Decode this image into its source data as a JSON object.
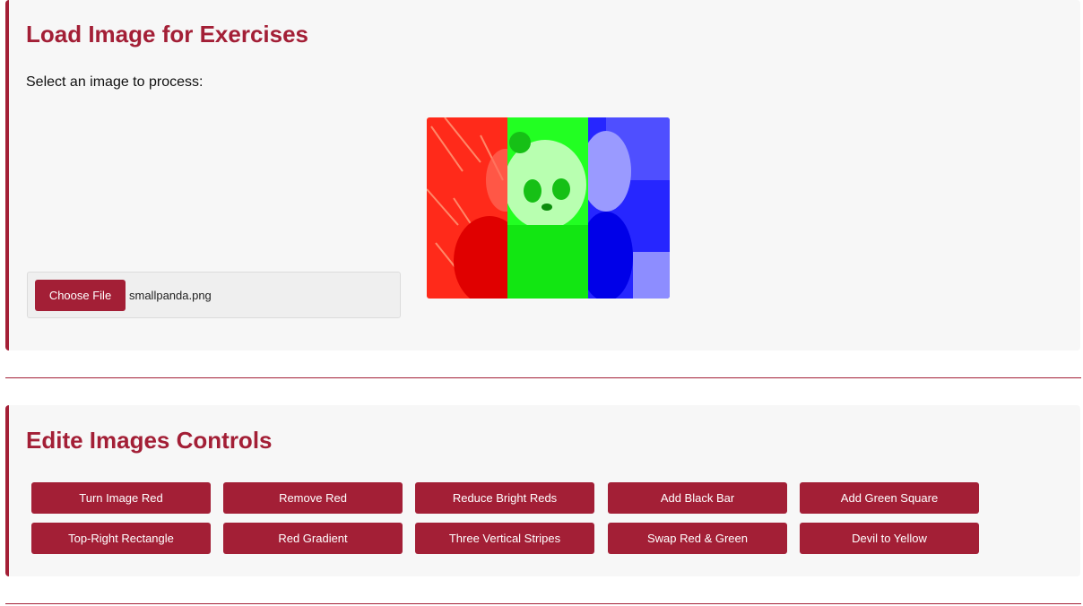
{
  "load_section": {
    "title": "Load Image for Exercises",
    "select_label": "Select an image to process:",
    "choose_file_label": "Choose File",
    "file_name": "smallpanda.png"
  },
  "preview": {
    "stripe_colors": [
      "#ff2a1a",
      "#22ff22",
      "#2626ff"
    ]
  },
  "edit_section": {
    "title": "Edite Images Controls",
    "buttons": [
      "Turn Image Red",
      "Remove Red",
      "Reduce Bright Reds",
      "Add Black Bar",
      "Add Green Square",
      "Top-Right Rectangle",
      "Red Gradient",
      "Three Vertical Stripes",
      "Swap Red & Green",
      "Devil to Yellow"
    ]
  },
  "colors": {
    "accent": "#a31f36",
    "card_background": "#f7f7f7"
  }
}
